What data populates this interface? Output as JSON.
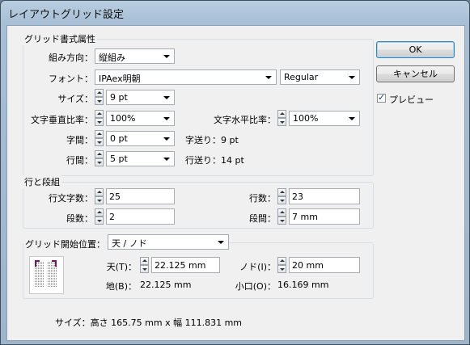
{
  "window": {
    "title": "レイアウトグリッド設定"
  },
  "grid_attrs": {
    "group_label": "グリッド書式属性",
    "direction": {
      "label": "組み方向：",
      "value": "縦組み"
    },
    "font": {
      "label": "フォント：",
      "value": "IPAex明朝",
      "style": "Regular"
    },
    "size": {
      "label": "サイズ：",
      "value": "9 pt"
    },
    "v_ratio": {
      "label": "文字垂直比率：",
      "value": "100%"
    },
    "h_ratio": {
      "label": "文字水平比率：",
      "value": "100%"
    },
    "char_gap": {
      "label": "字間：",
      "value": "0 pt",
      "info": "字送り：9 pt"
    },
    "line_gap": {
      "label": "行間：",
      "value": "5 pt",
      "info": "行送り：14 pt"
    }
  },
  "lines_cols": {
    "group_label": "行と段組",
    "chars_per_line": {
      "label": "行文字数：",
      "value": "25"
    },
    "lines": {
      "label": "行数：",
      "value": "23"
    },
    "columns": {
      "label": "段数：",
      "value": "2"
    },
    "gutter": {
      "label": "段間：",
      "value": "7 mm"
    }
  },
  "grid_start": {
    "label": "グリッド開始位置：",
    "value": "天 / ノド",
    "top": {
      "label": "天(T)：",
      "value": "22.125 mm"
    },
    "inside": {
      "label": "ノド(I)：",
      "value": "20 mm"
    },
    "bottom": {
      "label": "地(B)：",
      "value": "22.125 mm"
    },
    "outside": {
      "label": "小口(O)：",
      "value": "16.169 mm"
    }
  },
  "footer": {
    "size_info": "サイズ：高さ 165.75 mm x 幅 111.831 mm"
  },
  "buttons": {
    "ok": "OK",
    "cancel": "キャンセル",
    "preview": "プレビュー",
    "preview_checked": true
  }
}
